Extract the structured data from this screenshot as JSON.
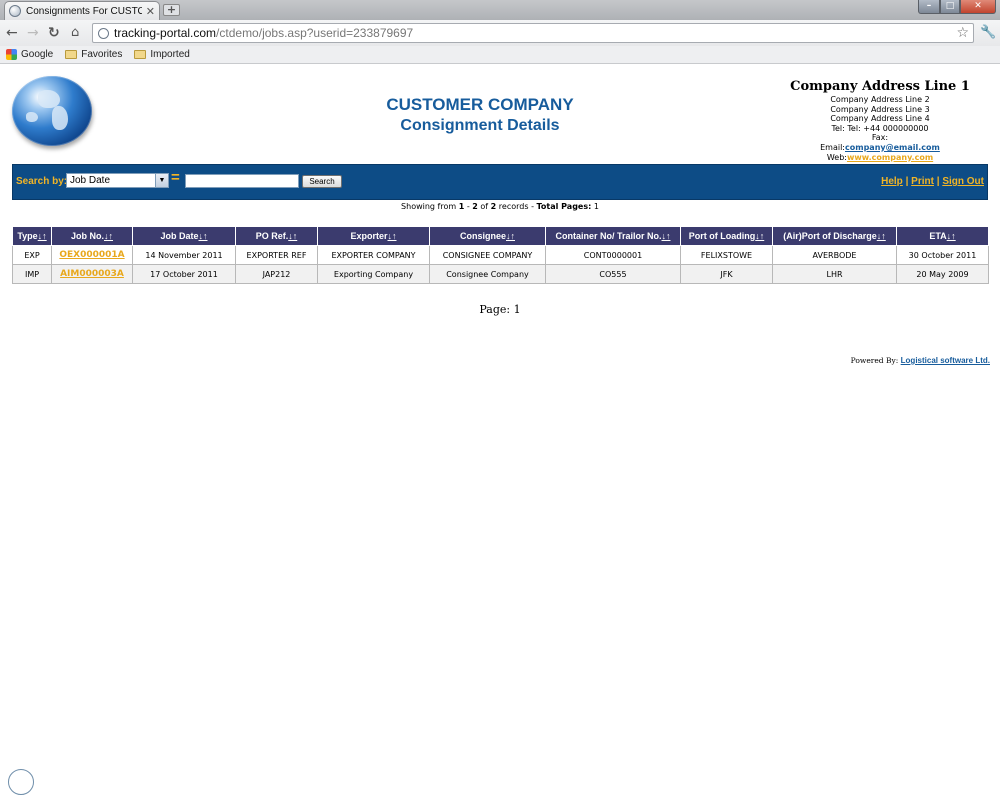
{
  "browser": {
    "tab_title": "Consignments For CUSTOM",
    "url_host": "tracking-portal.com",
    "url_path": "/ctdemo/jobs.asp?userid=233879697",
    "bookmarks": [
      "Google",
      "Favorites",
      "Imported"
    ],
    "icons": [
      "page-favicon",
      "new-tab-plus",
      "minimize",
      "maximize",
      "close",
      "back-arrow",
      "forward-arrow",
      "reload",
      "home",
      "star",
      "wrench"
    ]
  },
  "header": {
    "company_name": "CUSTOMER COMPANY",
    "page_title": "Consignment Details",
    "address": {
      "line1": "Company Address Line 1",
      "line2": "Company Address Line 2",
      "line3": "Company Address Line 3",
      "line4": "Company Address Line 4",
      "tel": "Tel: Tel: +44 000000000",
      "fax": "Fax:",
      "email_label": "Email:",
      "email": "company@email.com",
      "web_label": "Web:",
      "web": "www.company.com"
    }
  },
  "search": {
    "label": "Search by:",
    "field": "Job Date",
    "equals": "=",
    "value": "",
    "button": "Search"
  },
  "links": {
    "help": "Help",
    "print": "Print",
    "sign_out": "Sign Out",
    "separator": "|"
  },
  "records": {
    "prefix": "Showing from",
    "from": "1",
    "dash": "-",
    "to": "2",
    "of": "of",
    "total": "2",
    "suffix": "records -",
    "pages_label": "Total Pages:",
    "pages": "1"
  },
  "table": {
    "sort_glyph": "↓↑",
    "columns": [
      "Type",
      "Job No.",
      "Job Date",
      "PO Ref.",
      "Exporter",
      "Consignee",
      "Container No/ Trailor No.",
      "Port of Loading",
      "(Air)Port of Discharge",
      "ETA"
    ],
    "rows": [
      [
        "EXP",
        "OEX000001A",
        "14 November 2011",
        "EXPORTER REF",
        "EXPORTER COMPANY",
        "CONSIGNEE COMPANY",
        "CONT0000001",
        "FELIXSTOWE",
        "AVERBODE",
        "30 October 2011"
      ],
      [
        "IMP",
        "AIM000003A",
        "17 October 2011",
        "JAP212",
        "Exporting Company",
        "Consignee Company",
        "CO555",
        "JFK",
        "LHR",
        "20 May 2009"
      ]
    ]
  },
  "pager": {
    "text": "Page: 1"
  },
  "footer": {
    "powered_by": "Powered By:",
    "vendor": "Logistical software Ltd."
  },
  "colors": {
    "brand_blue": "#175c9c",
    "search_bar": "#0d4c86",
    "accent_orange": "#f2b526",
    "header_row": "#3b3b6e"
  }
}
